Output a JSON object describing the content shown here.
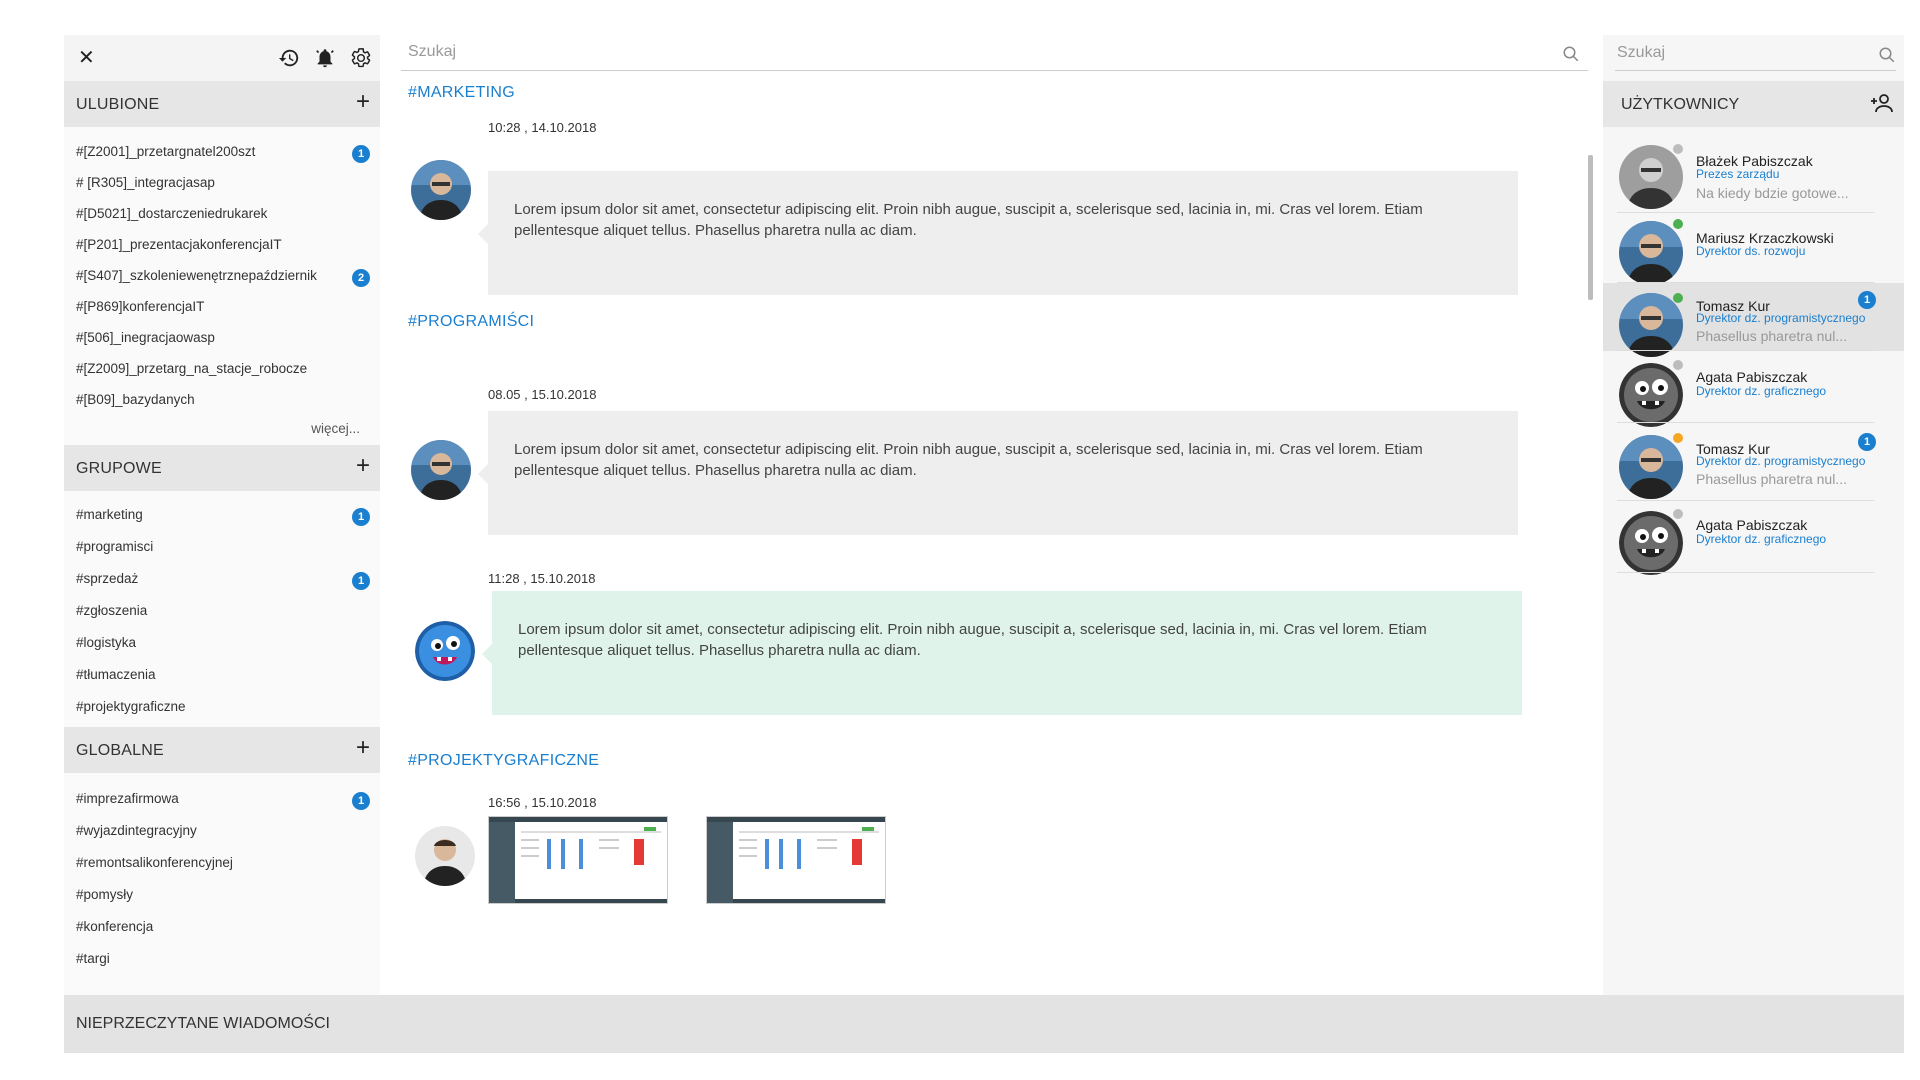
{
  "left": {
    "close_glyph": "✕",
    "icons": [
      "history-icon",
      "bell-icon",
      "gear-icon"
    ],
    "favorites": {
      "title": "ULUBIONE",
      "items": [
        {
          "name": "#[Z2001]_przetargnatel200szt",
          "badge": "1"
        },
        {
          "name": "# [R305]_integracjasap",
          "badge": ""
        },
        {
          "name": "#[D5021]_dostarczeniedrukarek",
          "badge": ""
        },
        {
          "name": "#[P201]_prezentacjakonferencjaIT",
          "badge": ""
        },
        {
          "name": "#[S407]_szkoleniewenętrznepaździernik",
          "badge": "2"
        },
        {
          "name": "#[P869]konferencjaIT",
          "badge": ""
        },
        {
          "name": "#[506]_inegracjaowasp",
          "badge": ""
        },
        {
          "name": "#[Z2009]_przetarg_na_stacje_robocze",
          "badge": ""
        },
        {
          "name": "#[B09]_bazydanych",
          "badge": ""
        }
      ],
      "more": "więcej..."
    },
    "groups": {
      "title": "GRUPOWE",
      "items": [
        {
          "name": "#marketing",
          "badge": "1"
        },
        {
          "name": "#programisci",
          "badge": ""
        },
        {
          "name": "#sprzedaż",
          "badge": "1"
        },
        {
          "name": "#zgłoszenia",
          "badge": ""
        },
        {
          "name": "#logistyka",
          "badge": ""
        },
        {
          "name": "#tłumaczenia",
          "badge": ""
        },
        {
          "name": "#projektygraficzne",
          "badge": ""
        }
      ]
    },
    "globals": {
      "title": "GLOBALNE",
      "items": [
        {
          "name": "#imprezafirmowa",
          "badge": "1"
        },
        {
          "name": "#wyjazdintegracyjny",
          "badge": ""
        },
        {
          "name": "#remontsalikonferencyjnej",
          "badge": ""
        },
        {
          "name": "#pomysły",
          "badge": ""
        },
        {
          "name": "#konferencja",
          "badge": ""
        },
        {
          "name": "#targi",
          "badge": ""
        }
      ]
    },
    "plus_glyph": "+"
  },
  "bottom": {
    "label": "NIEPRZECZYTANE WIADOMOŚCI"
  },
  "center": {
    "search_placeholder": "Szukaj",
    "channels": [
      {
        "title": "#MARKETING",
        "time": "10:28 , 14.10.2018",
        "text": "Lorem ipsum dolor sit amet, consectetur adipiscing elit. Proin nibh augue, suscipit a, scelerisque sed, lacinia in, mi. Cras vel lorem. Etiam pellentesque aliquet tellus. Phasellus pharetra nulla ac diam."
      },
      {
        "title": "#PROGRAMIŚCI",
        "time": "08.05 , 15.10.2018",
        "text": "Lorem ipsum dolor sit amet, consectetur adipiscing elit. Proin nibh augue, suscipit a, scelerisque sed, lacinia in, mi. Cras vel lorem. Etiam pellentesque aliquet tellus. Phasellus pharetra nulla ac diam."
      },
      {
        "title": "",
        "time": "11:28 , 15.10.2018",
        "text": "Lorem ipsum dolor sit amet, consectetur adipiscing elit. Proin nibh augue, suscipit a, scelerisque sed, lacinia in, mi. Cras vel lorem. Etiam pellentesque aliquet tellus. Phasellus pharetra nulla ac diam."
      },
      {
        "title": "#PROJEKTYGRAFICZNE",
        "time": "16:56 , 15.10.2018",
        "text": ""
      }
    ]
  },
  "right": {
    "search_placeholder": "Szukaj",
    "title": "UŻYTKOWNICY",
    "users": [
      {
        "name": "Błażek Pabiszczak",
        "role": "Prezes zarządu",
        "msg": "Na kiedy bdzie gotowe...",
        "status": "#bdbdbd",
        "badge": "",
        "avatar": "person"
      },
      {
        "name": "Mariusz Krzaczkowski",
        "role": "Dyrektor ds. rozwoju",
        "msg": "",
        "status": "#4caf50",
        "badge": "",
        "avatar": "person"
      },
      {
        "name": "Tomasz Kur",
        "role": "Dyrektor dz. programistycznego",
        "msg": "Phasellus pharetra nul...",
        "status": "#4caf50",
        "badge": "1",
        "avatar": "person"
      },
      {
        "name": "Agata Pabiszczak",
        "role": "Dyrektor dz. graficznego",
        "msg": "",
        "status": "#bdbdbd",
        "badge": "",
        "avatar": "monster"
      },
      {
        "name": "Tomasz Kur",
        "role": "Dyrektor dz. programistycznego",
        "msg": "Phasellus pharetra nul...",
        "status": "#f5a623",
        "badge": "1",
        "avatar": "person"
      },
      {
        "name": "Agata Pabiszczak",
        "role": "Dyrektor dz. graficznego",
        "msg": "",
        "status": "#bdbdbd",
        "badge": "",
        "avatar": "monster"
      }
    ]
  },
  "colors": {
    "accent": "#1a7fcf",
    "bubble": "#eeeeee",
    "bubble_own": "#dff3ea"
  }
}
